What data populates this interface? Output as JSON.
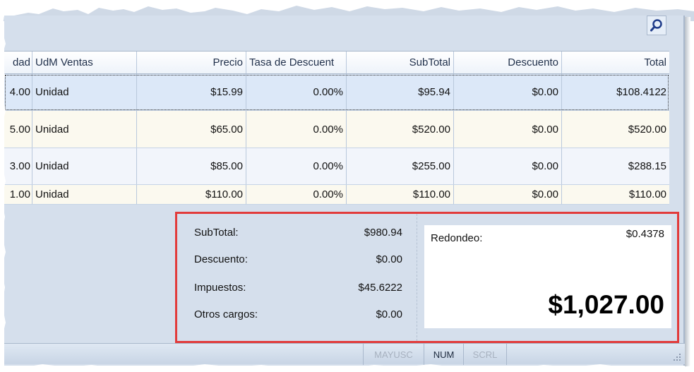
{
  "grid": {
    "headers": [
      "Cantidad",
      "UdM Ventas",
      "Precio",
      "Tasa de Descuent",
      "SubTotal",
      "Descuento",
      "Total"
    ],
    "header_visible": [
      "dad",
      "UdM Ventas",
      "Precio",
      "Tasa de Descuent",
      "SubTotal",
      "Descuento",
      "Total"
    ],
    "rows": [
      {
        "qty": "4.00",
        "uom": "Unidad",
        "price": "$15.99",
        "rate": "0.00%",
        "subtotal": "$95.94",
        "discount": "$0.00",
        "total": "$108.4122"
      },
      {
        "qty": "5.00",
        "uom": "Unidad",
        "price": "$65.00",
        "rate": "0.00%",
        "subtotal": "$520.00",
        "discount": "$0.00",
        "total": "$520.00"
      },
      {
        "qty": "3.00",
        "uom": "Unidad",
        "price": "$85.00",
        "rate": "0.00%",
        "subtotal": "$255.00",
        "discount": "$0.00",
        "total": "$288.15"
      },
      {
        "qty": "1.00",
        "uom": "Unidad",
        "price": "$110.00",
        "rate": "0.00%",
        "subtotal": "$110.00",
        "discount": "$0.00",
        "total": "$110.00"
      }
    ]
  },
  "summary": {
    "subtotal_label": "SubTotal:",
    "subtotal_value": "$980.94",
    "discount_label": "Descuento:",
    "discount_value": "$0.00",
    "taxes_label": "Impuestos:",
    "taxes_value": "$45.6222",
    "other_label": "Otros cargos:",
    "other_value": "$0.00",
    "rounding_label": "Redondeo:",
    "rounding_value": "$0.4378",
    "grand_total": "$1,027.00"
  },
  "statusbar": {
    "caps": "MAYUSC",
    "num": "NUM",
    "scroll": "SCRL"
  },
  "icons": {
    "search": "search-icon",
    "grip": "resize-grip-icon"
  },
  "colors": {
    "highlight": "#e23b3b",
    "panel": "#d5dfec",
    "selected_row": "#dce8f8"
  }
}
